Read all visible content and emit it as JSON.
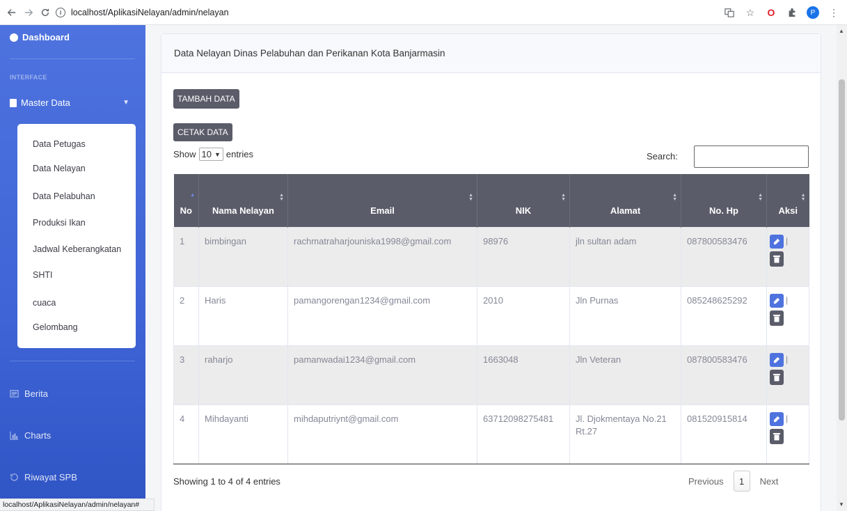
{
  "browser": {
    "url": "localhost/AplikasiNelayan/admin/nelayan",
    "profile_initial": "P",
    "status_url": "localhost/AplikasiNelayan/admin/nelayan#"
  },
  "sidebar": {
    "brand": "Dashboard",
    "heading": "INTERFACE",
    "master": "Master Data",
    "submenu": [
      "Data Petugas",
      "Data Nelayan",
      "Data Pelabuhan",
      "Produksi Ikan",
      "Jadwal Keberangkatan",
      "SHTI",
      "cuaca",
      "Gelombang"
    ],
    "items": [
      "Berita",
      "Charts",
      "Riwayat SPB"
    ]
  },
  "card": {
    "title": "Data Nelayan Dinas Pelabuhan dan Perikanan Kota Banjarmasin",
    "add_button": "TAMBAH DATA",
    "print_button": "CETAK DATA",
    "show_label": "Show",
    "entries_value": "10",
    "entries_label": "entries",
    "search_label": "Search:",
    "search_value": ""
  },
  "table": {
    "headers": [
      "No",
      "Nama Nelayan",
      "Email",
      "NIK",
      "Alamat",
      "No. Hp",
      "Aksi"
    ],
    "rows": [
      {
        "no": "1",
        "nama": "bimbingan",
        "email": "rachmatraharjouniska1998@gmail.com",
        "nik": "98976",
        "alamat": "jln sultan adam",
        "hp": "087800583476"
      },
      {
        "no": "2",
        "nama": "Haris",
        "email": "pamangorengan1234@gmail.com",
        "nik": "2010",
        "alamat": "Jln Purnas",
        "hp": "085248625292"
      },
      {
        "no": "3",
        "nama": "raharjo",
        "email": "pamanwadai1234@gmail.com",
        "nik": "1663048",
        "alamat": "Jln Veteran",
        "hp": "087800583476"
      },
      {
        "no": "4",
        "nama": "Mihdayanti",
        "email": "mihdaputriynt@gmail.com",
        "nik": "63712098275481",
        "alamat": "Jl. Djokmentaya No.21 Rt.27",
        "hp": "081520915814"
      }
    ],
    "pipe": "|"
  },
  "footer": {
    "showing": "Showing 1 to 4 of 4 entries",
    "previous": "Previous",
    "page": "1",
    "next": "Next"
  },
  "colors": {
    "sidebar": "#4e73df",
    "header_dark": "#5a5c69",
    "edit_button": "#4e73df"
  }
}
